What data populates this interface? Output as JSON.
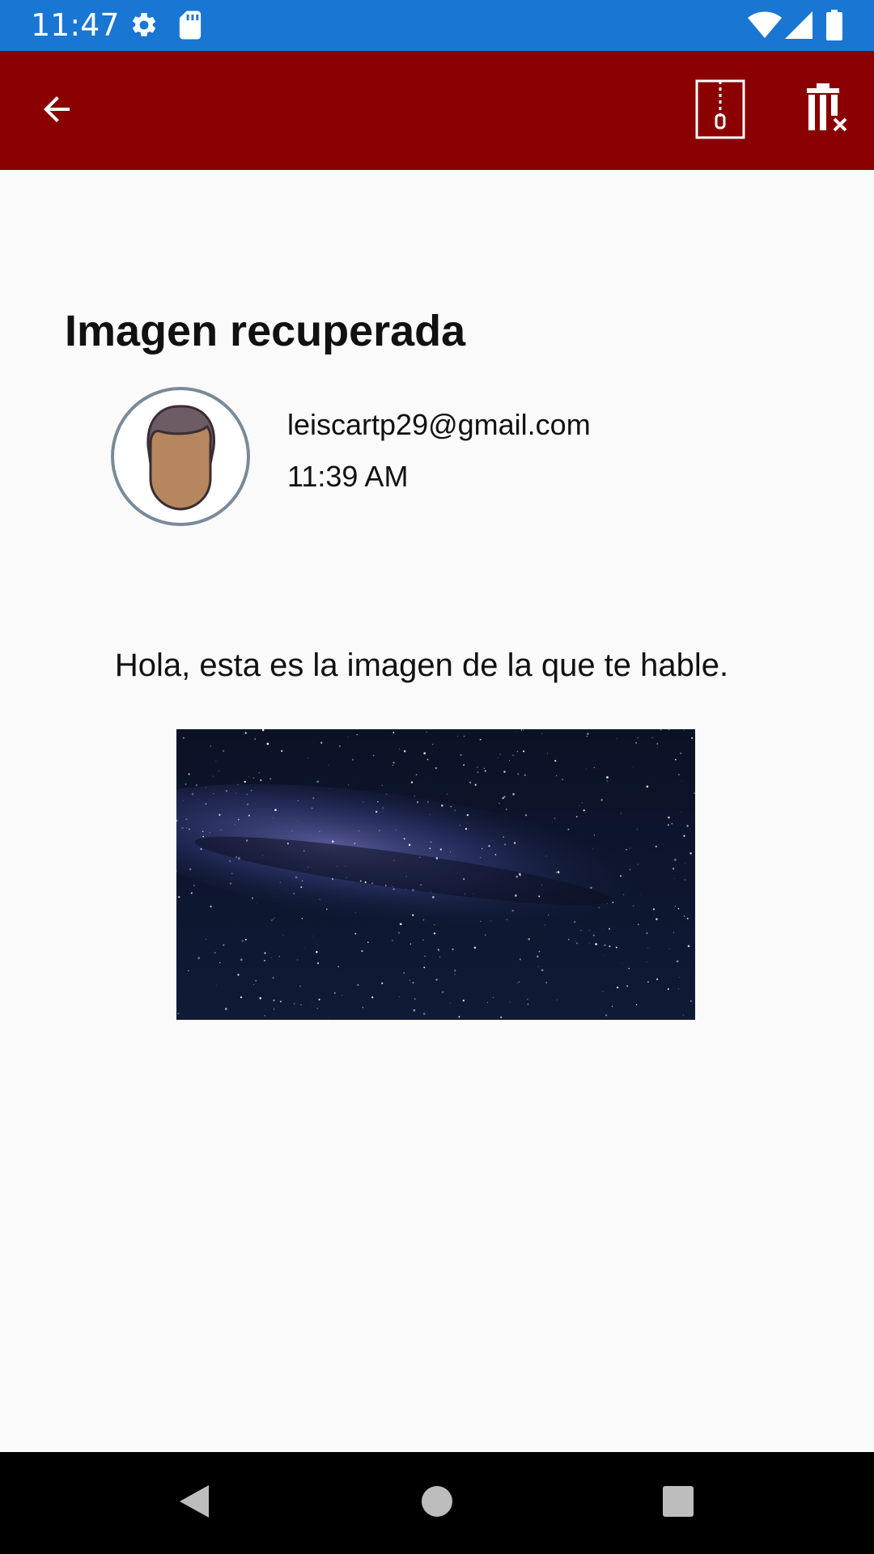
{
  "status_bar": {
    "time": "11:47",
    "icons": [
      "gear-icon",
      "sd-card-icon",
      "wifi-icon",
      "signal-icon",
      "battery-icon"
    ],
    "background": "#1976d2"
  },
  "app_bar": {
    "background": "#8b0000",
    "actions": [
      "back-arrow-icon",
      "zip-archive-icon",
      "delete-icon"
    ]
  },
  "content": {
    "title": "Imagen recuperada",
    "sender_email": "leiscartp29@gmail.com",
    "sent_time": "11:39 AM",
    "message": "Hola, esta es la imagen de la que te hable."
  },
  "navigation_bar": {
    "buttons": [
      "back-triangle-icon",
      "home-circle-icon",
      "recents-square-icon"
    ]
  }
}
